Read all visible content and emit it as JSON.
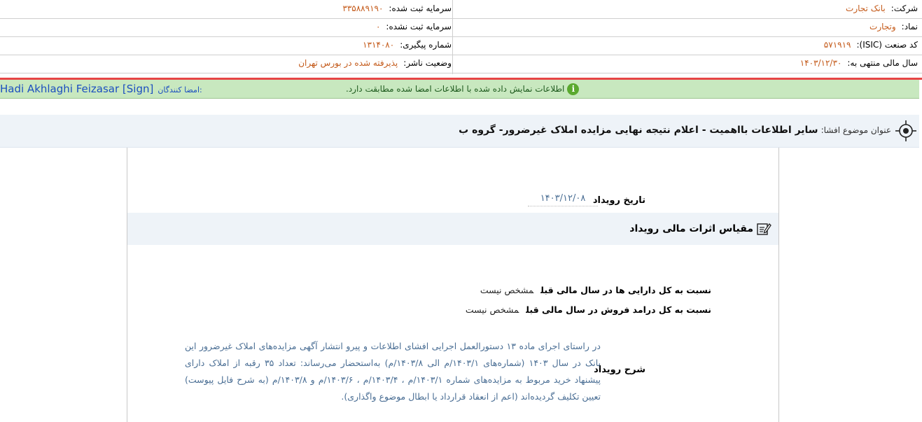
{
  "info": {
    "company_label": "شرکت:",
    "company_value": "بانک تجارت",
    "registered_capital_label": "سرمایه ثبت شده:",
    "registered_capital_value": "۳۳۵۸۸۹۱۹۰",
    "symbol_label": "نماد:",
    "symbol_value": "وتجارت",
    "unregistered_capital_label": "سرمایه ثبت نشده:",
    "unregistered_capital_value": "۰",
    "isic_label": "کد صنعت (ISIC):",
    "isic_value": "۵۷۱۹۱۹",
    "tracking_label": "شماره پیگیری:",
    "tracking_value": "۱۳۱۴۰۸۰",
    "fiscal_year_label": "سال مالی منتهی به:",
    "fiscal_year_value": "۱۴۰۳/۱۲/۳۰",
    "publisher_status_label": "وضعیت ناشر:",
    "publisher_status_value": "پذیرفته شده در بورس تهران"
  },
  "notice": {
    "message": "اطلاعات نمایش داده شده با اطلاعات امضا شده مطابقت دارد.",
    "icon_glyph": "i",
    "signers_label": "امضا کنندگان:",
    "signer_name": "Hadi Akhlaghi Feizasar [Sign]"
  },
  "disclosure": {
    "subject_label": "عنوان موضوع افشا:",
    "subject_value": "سایر اطلاعات بااهمیت - اعلام نتیجه نهایی مزایده املاک غیرضرور- گروه ب"
  },
  "event": {
    "date_label": "تاریخ رویداد",
    "date_value": "۱۴۰۳/۱۲/۰۸",
    "financial_section_title": "مقیاس اثرات مالی رویداد",
    "assets_ratio_label": "نسبت به کل دارایی ها در سال مالی قبل",
    "assets_ratio_value": "مشخص نیست",
    "revenue_ratio_label": "نسبت به کل درامد فروش در سال مالی قبل",
    "revenue_ratio_value": "مشخص نیست",
    "description_label": "شرح رویداد",
    "description_text": "در راستای اجرای ماده ۱۳ دستورالعمل اجرایی افشای اطلاعات و پیرو انتشار آگهی مزایده‌های املاک غیرضرور این بانک در سال ۱۴۰۳ (شماره‌های ۱۴۰۳/۱/م الی ۱۴۰۳/۸/م) به‌استحضار می‌رساند: تعداد ۳۵ رقبه از املاک دارای پیشنهاد خرید مربوط به مزایده‌های شماره ۱۴۰۳/۱/م ، ۱۴۰۳/۴/م ، ۱۴۰۳/۶/م و ۱۴۰۳/۸/م (به شرح فایل پیوست) تعیین تکلیف گردیده‌اند (اعم از انعقاد قرارداد یا ابطال موضوع واگذاری)."
  },
  "colors": {
    "value_orange": "#c45a1a",
    "link_blue": "#1c4fbf",
    "notice_green": "#c8e8bf",
    "alert_red": "#e74545",
    "text_blue_gray": "#4a6e94"
  }
}
